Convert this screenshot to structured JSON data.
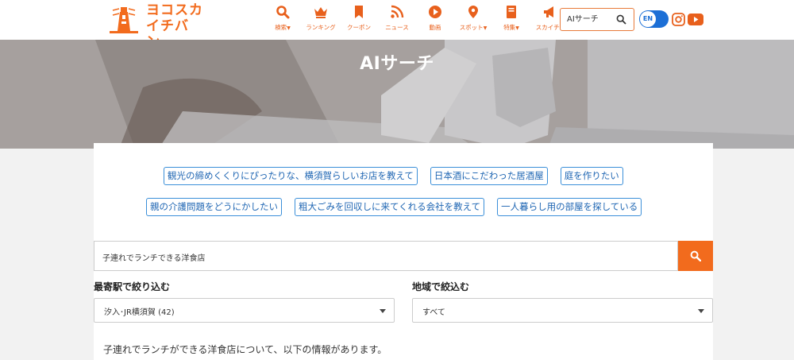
{
  "header": {
    "logo_text_line1": "ヨコスカ",
    "logo_text_line2": "イチバン",
    "nav": [
      {
        "label": "検索",
        "icon": "search-icon",
        "caret": true
      },
      {
        "label": "ランキング",
        "icon": "crown-icon",
        "caret": false
      },
      {
        "label": "クーポン",
        "icon": "bookmark-icon",
        "caret": false
      },
      {
        "label": "ニュース",
        "icon": "rss-icon",
        "caret": false
      },
      {
        "label": "動画",
        "icon": "play-icon",
        "caret": false
      },
      {
        "label": "スポット",
        "icon": "map-pin-icon",
        "caret": true
      },
      {
        "label": "特集",
        "icon": "book-icon",
        "caret": true
      },
      {
        "label": "スカイチ",
        "icon": "megaphone-icon",
        "caret": true
      }
    ],
    "search_placeholder": "AIサーチ",
    "lang_toggle": "EN",
    "accent_color": "#f26b1d",
    "toggle_color": "#1c6fd6"
  },
  "hero": {
    "title": "AIサーチ"
  },
  "suggestions_row1": [
    "観光の締めくくりにぴったりな、横須賀らしいお店を教えて",
    "日本酒にこだわった居酒屋",
    "庭を作りたい"
  ],
  "suggestions_row2": [
    "親の介護問題をどうにかしたい",
    "粗大ごみを回収しに来てくれる会社を教えて",
    "一人暮らし用の部屋を探している"
  ],
  "search": {
    "value": "子連れでランチできる洋食店"
  },
  "filters": {
    "station_label": "最寄駅で絞り込む",
    "station_value": "汐入･JR横須賀 (42)",
    "area_label": "地域で絞込む",
    "area_value": "すべて"
  },
  "result": {
    "intro": "子連れでランチができる洋食店について、以下の情報があります。"
  }
}
